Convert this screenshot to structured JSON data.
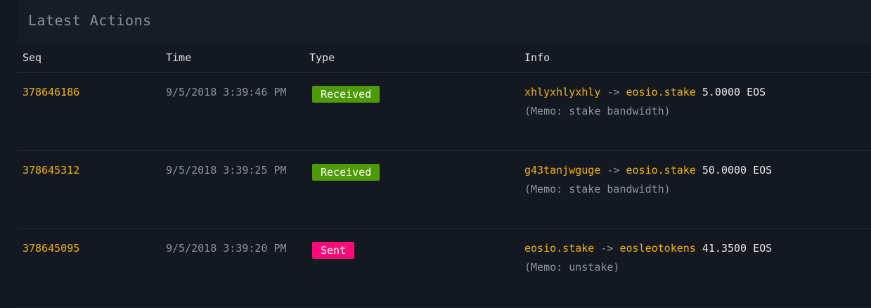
{
  "panel": {
    "title": "Latest Actions"
  },
  "table": {
    "columns": {
      "seq": "Seq",
      "time": "Time",
      "type": "Type",
      "info": "Info"
    },
    "rows": [
      {
        "seq": "378646186",
        "time": "9/5/2018 3:39:46 PM",
        "type": "Received",
        "type_color": "#4e9a06",
        "from": "xhlyxhlyxhly",
        "arrow": "->",
        "to": "eosio.stake",
        "amount": "5.0000 EOS",
        "memo": "(Memo: stake bandwidth)"
      },
      {
        "seq": "378645312",
        "time": "9/5/2018 3:39:25 PM",
        "type": "Received",
        "type_color": "#4e9a06",
        "from": "g43tanjwguge",
        "arrow": "->",
        "to": "eosio.stake",
        "amount": "50.0000 EOS",
        "memo": "(Memo: stake bandwidth)"
      },
      {
        "seq": "378645095",
        "time": "9/5/2018 3:39:20 PM",
        "type": "Sent",
        "type_color": "#ff0a78",
        "from": "eosio.stake",
        "arrow": "->",
        "to": "eosleotokens",
        "amount": "41.3500 EOS",
        "memo": "(Memo: unstake)"
      }
    ]
  },
  "colors": {
    "background": "#141820",
    "accent_link": "#f0b400",
    "received_badge": "#4e9a06",
    "sent_badge": "#ff0a78"
  }
}
